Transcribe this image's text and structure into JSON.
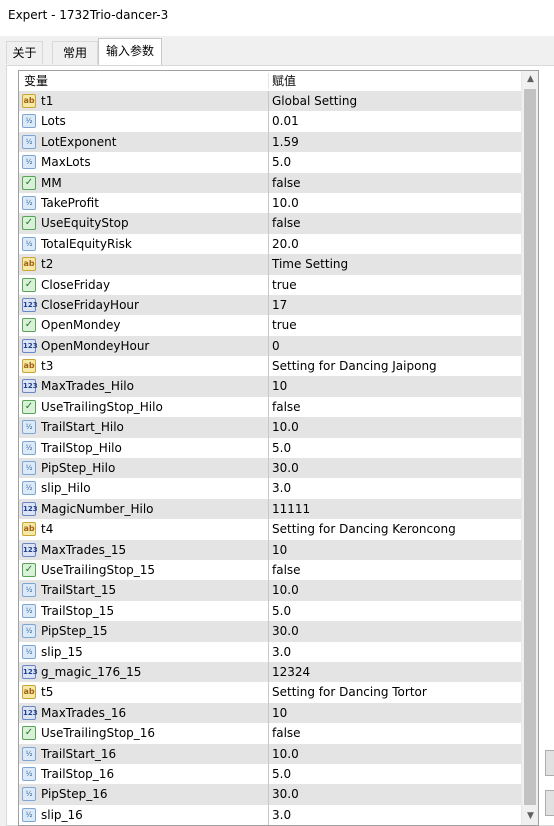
{
  "window": {
    "title": "Expert - 1732Trio-dancer-3"
  },
  "tabs": [
    {
      "label": "关于"
    },
    {
      "label": "常用"
    },
    {
      "label": "输入参数"
    }
  ],
  "grid": {
    "headers": {
      "variable": "变量",
      "value": "赋值"
    },
    "rows": [
      {
        "icon": "ab",
        "name": "t1",
        "value": "Global Setting"
      },
      {
        "icon": "va",
        "name": "Lots",
        "value": "0.01"
      },
      {
        "icon": "va",
        "name": "LotExponent",
        "value": "1.59"
      },
      {
        "icon": "va",
        "name": "MaxLots",
        "value": "5.0"
      },
      {
        "icon": "bool",
        "name": "MM",
        "value": "false"
      },
      {
        "icon": "va",
        "name": "TakeProfit",
        "value": "10.0"
      },
      {
        "icon": "bool",
        "name": "UseEquityStop",
        "value": "false"
      },
      {
        "icon": "va",
        "name": "TotalEquityRisk",
        "value": "20.0"
      },
      {
        "icon": "ab",
        "name": "t2",
        "value": "Time Setting"
      },
      {
        "icon": "bool",
        "name": "CloseFriday",
        "value": "true"
      },
      {
        "icon": "123",
        "name": "CloseFridayHour",
        "value": "17"
      },
      {
        "icon": "bool",
        "name": "OpenMondey",
        "value": "true"
      },
      {
        "icon": "123",
        "name": "OpenMondeyHour",
        "value": "0"
      },
      {
        "icon": "ab",
        "name": "t3",
        "value": "Setting for Dancing Jaipong"
      },
      {
        "icon": "123",
        "name": "MaxTrades_Hilo",
        "value": "10"
      },
      {
        "icon": "bool",
        "name": "UseTrailingStop_Hilo",
        "value": "false"
      },
      {
        "icon": "va",
        "name": "TrailStart_Hilo",
        "value": "10.0"
      },
      {
        "icon": "va",
        "name": "TrailStop_Hilo",
        "value": "5.0"
      },
      {
        "icon": "va",
        "name": "PipStep_Hilo",
        "value": "30.0"
      },
      {
        "icon": "va",
        "name": "slip_Hilo",
        "value": "3.0"
      },
      {
        "icon": "123",
        "name": "MagicNumber_Hilo",
        "value": "11111"
      },
      {
        "icon": "ab",
        "name": "t4",
        "value": "Setting for Dancing Keroncong"
      },
      {
        "icon": "123",
        "name": "MaxTrades_15",
        "value": "10"
      },
      {
        "icon": "bool",
        "name": "UseTrailingStop_15",
        "value": "false"
      },
      {
        "icon": "va",
        "name": "TrailStart_15",
        "value": "10.0"
      },
      {
        "icon": "va",
        "name": "TrailStop_15",
        "value": "5.0"
      },
      {
        "icon": "va",
        "name": "PipStep_15",
        "value": "30.0"
      },
      {
        "icon": "va",
        "name": "slip_15",
        "value": "3.0"
      },
      {
        "icon": "123",
        "name": "g_magic_176_15",
        "value": "12324"
      },
      {
        "icon": "ab",
        "name": "t5",
        "value": "Setting for Dancing Tortor"
      },
      {
        "icon": "123",
        "name": "MaxTrades_16",
        "value": "10"
      },
      {
        "icon": "bool",
        "name": "UseTrailingStop_16",
        "value": "false"
      },
      {
        "icon": "va",
        "name": "TrailStart_16",
        "value": "10.0"
      },
      {
        "icon": "va",
        "name": "TrailStop_16",
        "value": "5.0"
      },
      {
        "icon": "va",
        "name": "PipStep_16",
        "value": "30.0"
      },
      {
        "icon": "va",
        "name": "slip_16",
        "value": "3.0"
      }
    ]
  },
  "icons": {
    "ab": {
      "glyph": "ab",
      "semantic": "string-type-icon"
    },
    "va": {
      "glyph": "½",
      "semantic": "double-type-icon"
    },
    "bool": {
      "glyph": "✓",
      "semantic": "bool-type-icon"
    },
    "123": {
      "glyph": "123",
      "semantic": "integer-type-icon"
    }
  },
  "scrollbar": {
    "up_glyph": "▲",
    "down_glyph": "▼"
  }
}
